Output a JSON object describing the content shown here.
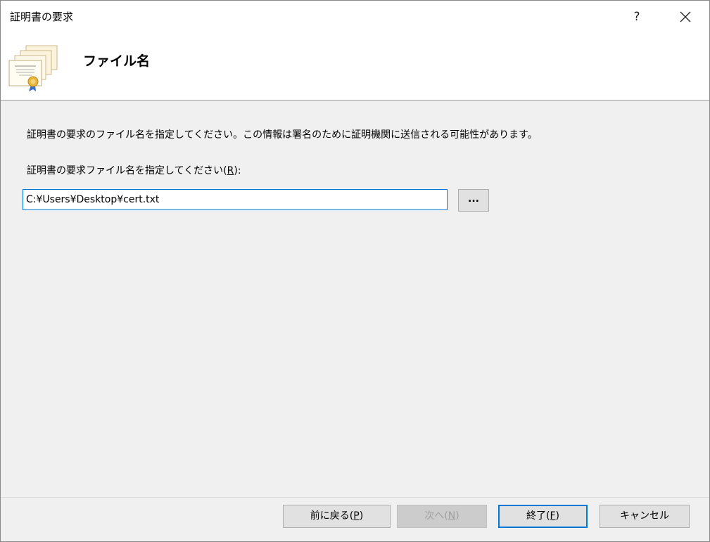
{
  "window": {
    "title": "証明書の要求",
    "help_label": "?"
  },
  "header": {
    "title": "ファイル名",
    "icon": "certificate-icon"
  },
  "main": {
    "description": "証明書の要求のファイル名を指定してください。この情報は署名のために証明機関に送信される可能性があります。",
    "field_label_prefix": "証明書の要求ファイル名を指定してください(",
    "field_label_key": "R",
    "field_label_suffix": "):",
    "filename_value": "C:¥Users¥Desktop¥cert.txt",
    "browse_label": "..."
  },
  "footer": {
    "back_prefix": "前に戻る(",
    "back_key": "P",
    "back_suffix": ")",
    "next_prefix": "次へ(",
    "next_key": "N",
    "next_suffix": ")",
    "finish_prefix": "終了(",
    "finish_key": "F",
    "finish_suffix": ")",
    "cancel_label": "キャンセル"
  },
  "colors": {
    "accent": "#0078d7",
    "dialog_background": "#f0f0f0",
    "button_face": "#e1e1e1",
    "disabled_text": "#a0a0a0"
  }
}
